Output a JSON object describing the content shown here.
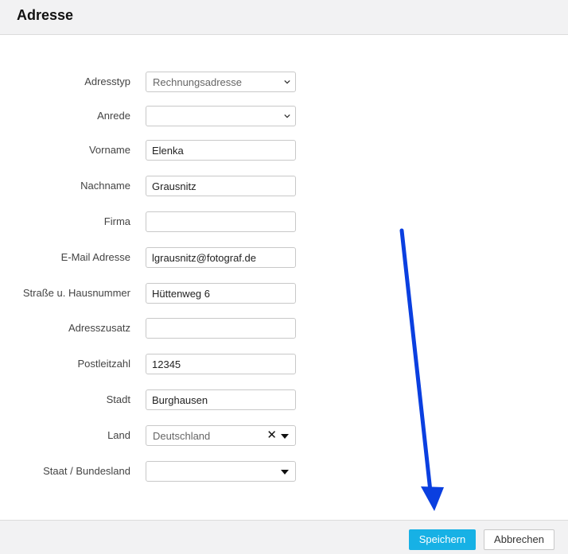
{
  "dialog": {
    "title": "Adresse"
  },
  "form": {
    "adresstyp": {
      "label": "Adresstyp",
      "value": "Rechnungsadresse"
    },
    "anrede": {
      "label": "Anrede",
      "value": ""
    },
    "vorname": {
      "label": "Vorname",
      "value": "Elenka"
    },
    "nachname": {
      "label": "Nachname",
      "value": "Grausnitz"
    },
    "firma": {
      "label": "Firma",
      "value": ""
    },
    "email": {
      "label": "E-Mail Adresse",
      "value": "lgrausnitz@fotograf.de"
    },
    "strasse": {
      "label": "Straße u. Hausnummer",
      "value": "Hüttenweg 6"
    },
    "adresszusatz": {
      "label": "Adresszusatz",
      "value": ""
    },
    "plz": {
      "label": "Postleitzahl",
      "value": "12345"
    },
    "stadt": {
      "label": "Stadt",
      "value": "Burghausen"
    },
    "land": {
      "label": "Land",
      "value": "Deutschland",
      "clear_glyph": "✕"
    },
    "staat": {
      "label": "Staat / Bundesland",
      "value": ""
    }
  },
  "footer": {
    "save_label": "Speichern",
    "cancel_label": "Abbrechen"
  },
  "colors": {
    "primary_button": "#17b1e5",
    "annotation_arrow": "#0a3fe0"
  },
  "icons": {
    "select_chevron": "chevron-down-icon",
    "dropdown_caret": "caret-down-icon",
    "clear": "clear-icon",
    "annotation": "arrow-down-annotation"
  }
}
